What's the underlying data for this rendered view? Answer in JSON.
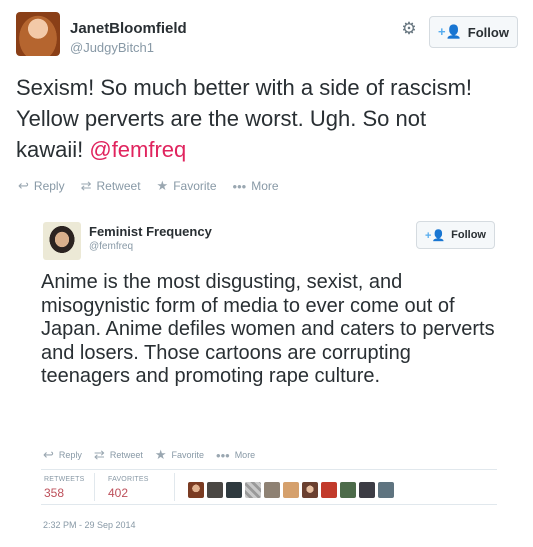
{
  "tweet": {
    "name": "JanetBloomfield",
    "handle": "@JudgyBitch1",
    "follow_label": "Follow",
    "text": "Sexism! So much better with a side of rascism! Yellow perverts are the worst. Ugh. So not kawaii! ",
    "mention": "@femfreq",
    "actions": {
      "reply": "Reply",
      "retweet": "Retweet",
      "favorite": "Favorite",
      "more": "More"
    }
  },
  "embedded": {
    "name": "Feminist Frequency",
    "handle": "@femfreq",
    "follow_label": "Follow",
    "text": "Anime is the most disgusting, sexist, and misogynistic form of media to ever come out of Japan. Anime defiles women and caters to perverts and losers. Those cartoons are corrupting teenagers and promoting rape culture.",
    "actions": {
      "reply": "Reply",
      "retweet": "Retweet",
      "favorite": "Favorite",
      "more": "More"
    },
    "stats": {
      "retweets_label": "RETWEETS",
      "retweets": "358",
      "favorites_label": "FAVORITES",
      "favorites": "402"
    },
    "timestamp": "2:32 PM - 29 Sep 2014",
    "favoriter_avatars": 11
  },
  "colors": {
    "accent_blue": "#55acee",
    "mention": "#e0245e",
    "stat_value": "#bd4f5a",
    "muted": "#8899a6",
    "text": "#292f33"
  }
}
